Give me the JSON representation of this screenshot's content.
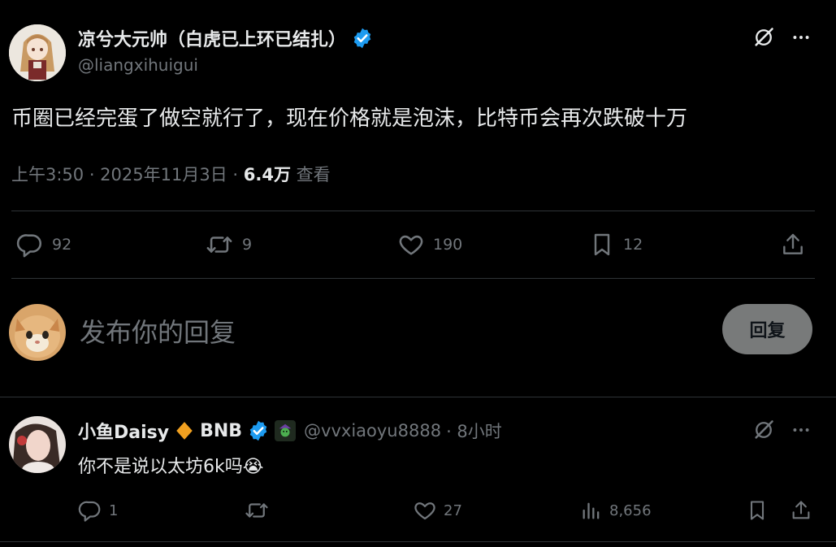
{
  "post": {
    "author_name": "凉兮大元帅（白虎已上环已结扎）",
    "handle": "@liangxihuigui",
    "text": "币圈已经完蛋了做空就行了，现在价格就是泡沫，比特币会再次跌破十万",
    "time": "上午3:50 · 2025年11月3日 · ",
    "views_count": "6.4万",
    "views_label": " 查看",
    "stats": {
      "replies": "92",
      "reposts": "9",
      "likes": "190",
      "bookmarks": "12"
    }
  },
  "composer": {
    "placeholder": "发布你的回复",
    "reply_button": "回复"
  },
  "reply": {
    "author_name": "小鱼Daisy",
    "author_suffix": "BNB",
    "handle": "@vvxiaoyu8888",
    "time": "· 8小时",
    "text": "你不是说以太坊6k吗",
    "emoji": "😭",
    "stats": {
      "replies": "1",
      "reposts": "",
      "likes": "27",
      "views": "8,656"
    }
  },
  "colors": {
    "verified": "#1d9bf0",
    "diamond": "#f0a020",
    "button_bg": "#787a7a"
  }
}
